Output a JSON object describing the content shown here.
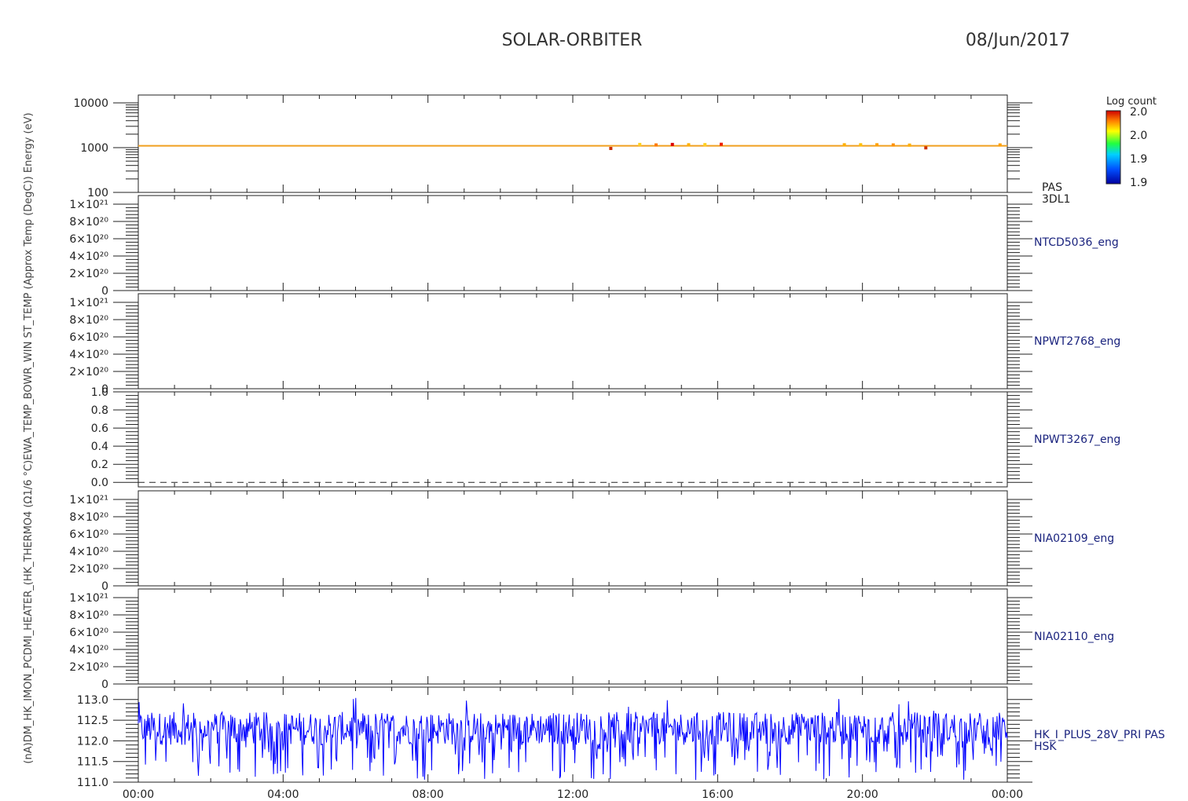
{
  "header": {
    "title": "SOLAR-ORBITER",
    "date": "08/Jun/2017"
  },
  "y_axis_label": "(nA)DM_HK_IMON_PCDMI_HEATER_(HK_THERMO4 (Ω1/6 °C)EWA_TEMP_BOWR_WIN ST_TEMP (Approx Temp (DegC)) Energy (eV)",
  "colorbar": {
    "title": "Log count",
    "ticks": [
      "2.0",
      "2.0",
      "1.9",
      "1.9"
    ]
  },
  "x_ticks": [
    "00:00",
    "04:00",
    "08:00",
    "12:00",
    "16:00",
    "20:00",
    "00:00"
  ],
  "chart_data": [
    {
      "type": "heatmap",
      "label": [
        "PAS",
        "3DL1"
      ],
      "scale": "log",
      "ylim": [
        100,
        15000
      ],
      "y_ticks": [
        "10000",
        "1000",
        "100"
      ],
      "band_energy_eV": 1100,
      "band_color": "#f0a020",
      "spots": [
        {
          "t": 13.05,
          "e": 960,
          "c": "#cc3000"
        },
        {
          "t": 13.85,
          "e": 1180,
          "c": "#ffd020"
        },
        {
          "t": 14.3,
          "e": 1150,
          "c": "#ff7a00"
        },
        {
          "t": 14.75,
          "e": 1180,
          "c": "#dd0000"
        },
        {
          "t": 15.2,
          "e": 1160,
          "c": "#ffb000"
        },
        {
          "t": 15.65,
          "e": 1170,
          "c": "#ffd020"
        },
        {
          "t": 16.1,
          "e": 1190,
          "c": "#ee2000"
        },
        {
          "t": 19.5,
          "e": 1160,
          "c": "#ffb000"
        },
        {
          "t": 19.95,
          "e": 1160,
          "c": "#ffc000"
        },
        {
          "t": 20.4,
          "e": 1160,
          "c": "#ffa000"
        },
        {
          "t": 20.85,
          "e": 1150,
          "c": "#ff9000"
        },
        {
          "t": 21.3,
          "e": 1140,
          "c": "#ffb000"
        },
        {
          "t": 21.75,
          "e": 990,
          "c": "#cc3000"
        },
        {
          "t": 23.8,
          "e": 1150,
          "c": "#ffa000"
        }
      ]
    },
    {
      "type": "line",
      "label": "NTCD5036_eng",
      "ylim": [
        0,
        1.1e+21
      ],
      "y_ticks": [
        "1×10²¹",
        "8×10²⁰",
        "6×10²⁰",
        "4×10²⁰",
        "2×10²⁰",
        "0"
      ],
      "y_tick_values": [
        1e+21,
        8e+20,
        6e+20,
        4e+20,
        2e+20,
        0
      ],
      "series": []
    },
    {
      "type": "line",
      "label": "NPWT2768_eng",
      "ylim": [
        0,
        1.1e+21
      ],
      "y_ticks": [
        "1×10²¹",
        "8×10²⁰",
        "6×10²⁰",
        "4×10²⁰",
        "2×10²⁰",
        "0"
      ],
      "y_tick_values": [
        1e+21,
        8e+20,
        6e+20,
        4e+20,
        2e+20,
        0
      ],
      "zero_dashed": true
    },
    {
      "type": "line",
      "label": "NPWT3267_eng",
      "ylim": [
        -0.05,
        1.0
      ],
      "y_ticks": [
        "1.0",
        "0.8",
        "0.6",
        "0.4",
        "0.2",
        "0.0"
      ],
      "y_tick_values": [
        1.0,
        0.8,
        0.6,
        0.4,
        0.2,
        0.0
      ],
      "zero_dashed": true
    },
    {
      "type": "line",
      "label": "NIA02109_eng",
      "ylim": [
        0,
        1.1e+21
      ],
      "y_ticks": [
        "1×10²¹",
        "8×10²⁰",
        "6×10²⁰",
        "4×10²⁰",
        "2×10²⁰",
        "0"
      ],
      "y_tick_values": [
        1e+21,
        8e+20,
        6e+20,
        4e+20,
        2e+20,
        0
      ],
      "zero_dashed": true
    },
    {
      "type": "line",
      "label": "NIA02110_eng",
      "ylim": [
        0,
        1.1e+21
      ],
      "y_ticks": [
        "1×10²¹",
        "8×10²⁰",
        "6×10²⁰",
        "4×10²⁰",
        "2×10²⁰",
        "0"
      ],
      "y_tick_values": [
        1e+21,
        8e+20,
        6e+20,
        4e+20,
        2e+20,
        0
      ],
      "zero_dashed": true
    },
    {
      "type": "line",
      "label": [
        "HK_I_PLUS_28V_PRI PAS",
        "HSK"
      ],
      "ylim": [
        111.0,
        113.3
      ],
      "y_ticks": [
        "113.0",
        "112.5",
        "112.0",
        "111.5",
        "111.0"
      ],
      "y_tick_values": [
        113.0,
        112.5,
        112.0,
        111.5,
        111.0
      ],
      "series_color": "#0000ff",
      "typical_range": [
        111.9,
        112.7
      ],
      "dip_min": 111.05,
      "spike_max": 113.05
    }
  ]
}
